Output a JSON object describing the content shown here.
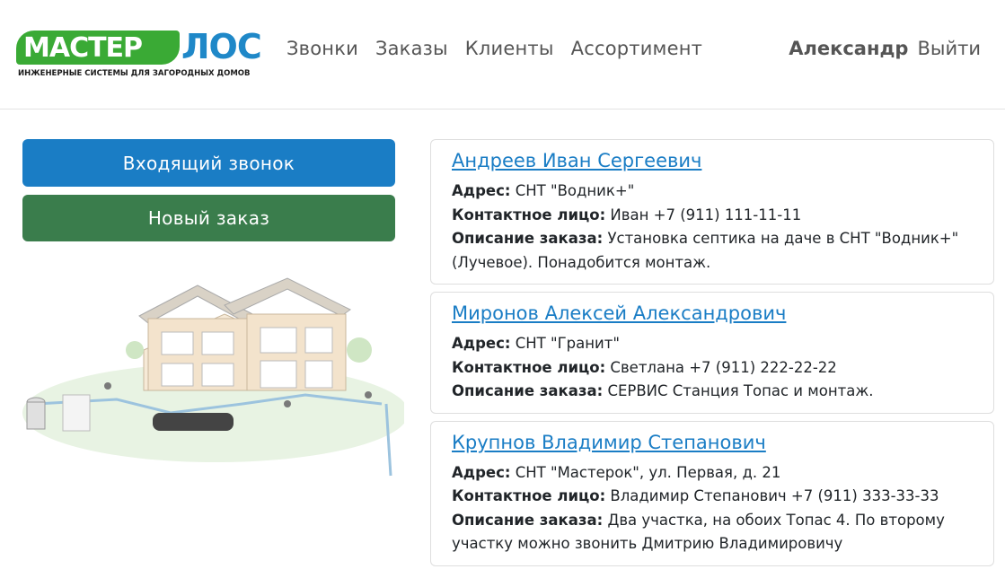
{
  "logo": {
    "brand_left": "МАСТЕР",
    "brand_right": "ЛОС",
    "tagline": "ИНЖЕНЕРНЫЕ СИСТЕМЫ ДЛЯ ЗАГОРОДНЫХ ДОМОВ"
  },
  "nav": {
    "items": [
      {
        "label": "Звонки"
      },
      {
        "label": "Заказы"
      },
      {
        "label": "Клиенты"
      },
      {
        "label": "Ассортимент"
      }
    ]
  },
  "user": {
    "name": "Александр",
    "logout_label": "Выйти"
  },
  "actions": {
    "incoming_call_label": "Входящий звонок",
    "new_order_label": "Новый заказ"
  },
  "labels": {
    "address": "Адрес:",
    "contact": "Контактное лицо:",
    "description": "Описание заказа:"
  },
  "clients": [
    {
      "name": "Андреев Иван Сергеевич",
      "address": "СНТ \"Водник+\"",
      "contact": "Иван +7 (911) 111-11-11",
      "description": "Установка септика на даче в СНТ \"Водник+\" (Лучевое). Понадобится монтаж."
    },
    {
      "name": "Миронов Алексей Александрович",
      "address": "СНТ \"Гранит\"",
      "contact": "Светлана +7 (911) 222-22-22",
      "description": "СЕРВИС Станция Топас и монтаж."
    },
    {
      "name": "Крупнов Владимир Степанович",
      "address": "СНТ \"Мастерок\", ул. Первая, д. 21",
      "contact": "Владимир Степанович +7 (911) 333-33-33",
      "description": "Два участка, на обоих Топас 4. По второму участку можно звонить Дмитрию Владимировичу"
    }
  ],
  "colors": {
    "brand_green": "#3aaa35",
    "brand_blue": "#1f88c8",
    "call_button": "#1a7dc5",
    "order_button": "#3a7d4c",
    "link": "#1a7dc5"
  }
}
